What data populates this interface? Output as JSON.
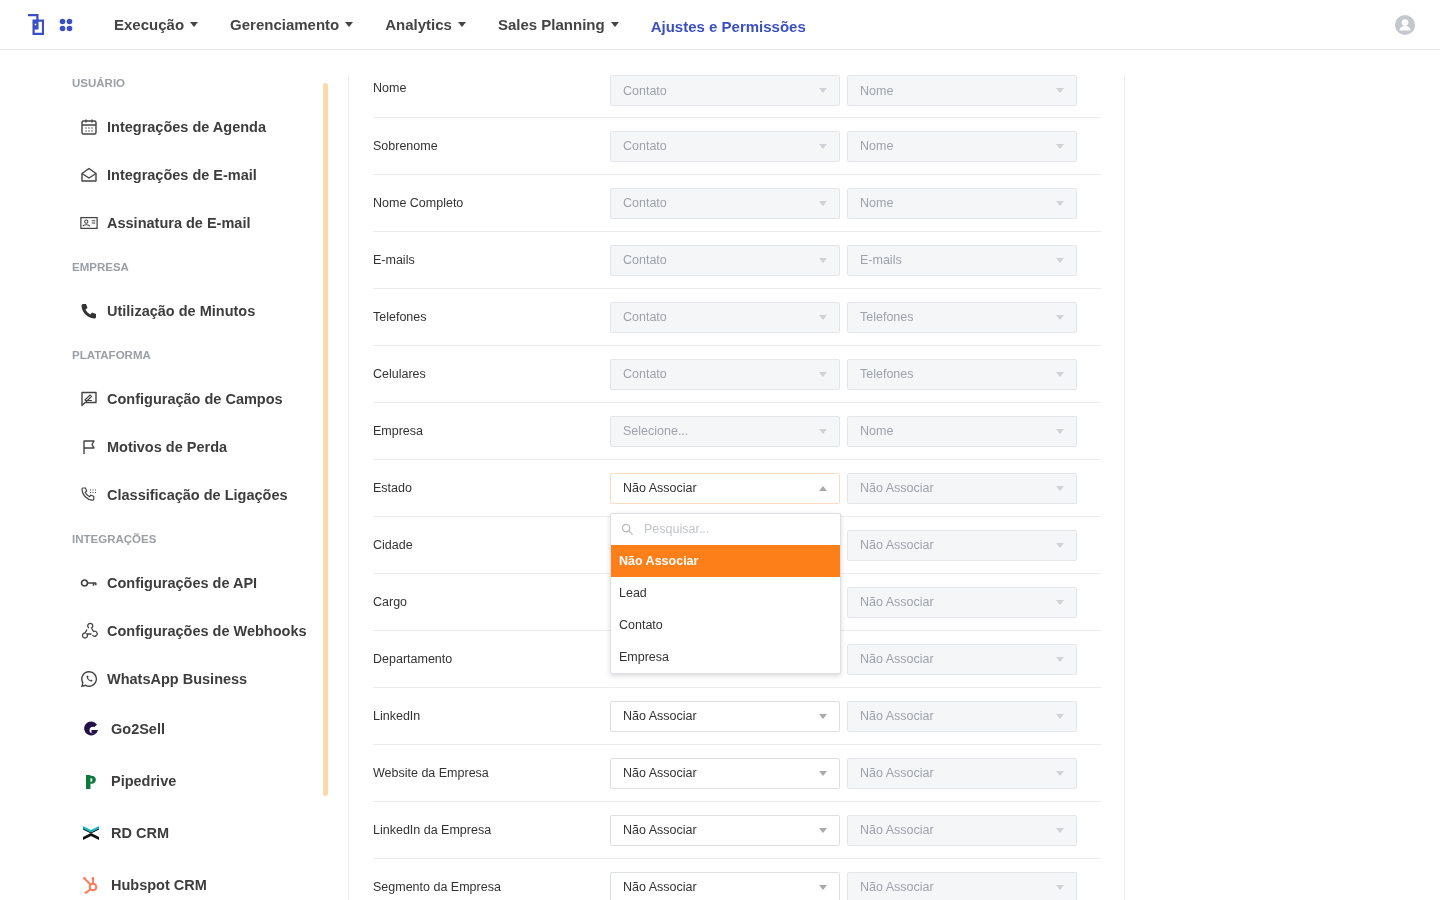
{
  "nav": {
    "items": [
      {
        "label": "Execução",
        "dropdown": true,
        "selected": false
      },
      {
        "label": "Gerenciamento",
        "dropdown": true,
        "selected": false
      },
      {
        "label": "Analytics",
        "dropdown": true,
        "selected": false
      },
      {
        "label": "Sales Planning",
        "dropdown": true,
        "selected": false
      },
      {
        "label": "Ajustes e Permissões",
        "dropdown": false,
        "selected": true
      }
    ]
  },
  "sidebar": {
    "sections": [
      {
        "title": "USUÁRIO",
        "items": [
          {
            "label": "Integrações de Agenda",
            "kind": "link"
          },
          {
            "label": "Integrações de E-mail",
            "kind": "link"
          },
          {
            "label": "Assinatura de E-mail",
            "kind": "link"
          }
        ]
      },
      {
        "title": "EMPRESA",
        "items": [
          {
            "label": "Utilização de Minutos",
            "kind": "link"
          }
        ]
      },
      {
        "title": "PLATAFORMA",
        "items": [
          {
            "label": "Configuração de Campos",
            "kind": "link"
          },
          {
            "label": "Motivos de Perda",
            "kind": "link"
          },
          {
            "label": "Classificação de Ligações",
            "kind": "link"
          }
        ]
      },
      {
        "title": "INTEGRAÇÕES",
        "items": [
          {
            "label": "Configurações de API",
            "kind": "link"
          },
          {
            "label": "Configurações de Webhooks",
            "kind": "link"
          },
          {
            "label": "WhatsApp Business",
            "kind": "link"
          },
          {
            "label": "Go2Sell",
            "kind": "brand"
          },
          {
            "label": "Pipedrive",
            "kind": "brand"
          },
          {
            "label": "RD CRM",
            "kind": "brand"
          },
          {
            "label": "Hubspot CRM",
            "kind": "brand"
          }
        ]
      }
    ]
  },
  "rows": [
    {
      "label": "Nome",
      "source": {
        "value": "Contato",
        "disabled": true
      },
      "target": {
        "value": "Nome",
        "disabled": true
      }
    },
    {
      "label": "Sobrenome",
      "source": {
        "value": "Contato",
        "disabled": true
      },
      "target": {
        "value": "Nome",
        "disabled": true
      }
    },
    {
      "label": "Nome Completo",
      "source": {
        "value": "Contato",
        "disabled": true
      },
      "target": {
        "value": "Nome",
        "disabled": true
      }
    },
    {
      "label": "E-mails",
      "source": {
        "value": "Contato",
        "disabled": true
      },
      "target": {
        "value": "E-mails",
        "disabled": true
      }
    },
    {
      "label": "Telefones",
      "source": {
        "value": "Contato",
        "disabled": true
      },
      "target": {
        "value": "Telefones",
        "disabled": true
      }
    },
    {
      "label": "Celulares",
      "source": {
        "value": "Contato",
        "disabled": true
      },
      "target": {
        "value": "Telefones",
        "disabled": true
      }
    },
    {
      "label": "Empresa",
      "source": {
        "placeholder": "Selecione...",
        "disabled": true
      },
      "target": {
        "value": "Nome",
        "disabled": true
      }
    },
    {
      "label": "Estado",
      "source": {
        "value": "Não Associar",
        "disabled": false,
        "open": true
      },
      "target": {
        "value": "Não Associar",
        "disabled": true
      }
    },
    {
      "label": "Cidade",
      "target": {
        "value": "Não Associar",
        "disabled": true
      }
    },
    {
      "label": "Cargo",
      "target": {
        "value": "Não Associar",
        "disabled": true
      }
    },
    {
      "label": "Departamento",
      "target": {
        "value": "Não Associar",
        "disabled": true
      }
    },
    {
      "label": "LinkedIn",
      "source": {
        "value": "Não Associar",
        "disabled": false
      },
      "target": {
        "value": "Não Associar",
        "disabled": true
      }
    },
    {
      "label": "Website da Empresa",
      "source": {
        "value": "Não Associar",
        "disabled": false
      },
      "target": {
        "value": "Não Associar",
        "disabled": true
      }
    },
    {
      "label": "LinkedIn da Empresa",
      "source": {
        "value": "Não Associar",
        "disabled": false
      },
      "target": {
        "value": "Não Associar",
        "disabled": true
      }
    },
    {
      "label": "Segmento da Empresa",
      "source": {
        "value": "Não Associar",
        "disabled": false
      },
      "target": {
        "value": "Não Associar",
        "disabled": true
      }
    }
  ],
  "dropdown": {
    "search_placeholder": "Pesquisar...",
    "options": [
      {
        "label": "Não Associar",
        "selected": true
      },
      {
        "label": "Lead",
        "selected": false
      },
      {
        "label": "Contato",
        "selected": false
      },
      {
        "label": "Empresa",
        "selected": false
      }
    ]
  }
}
